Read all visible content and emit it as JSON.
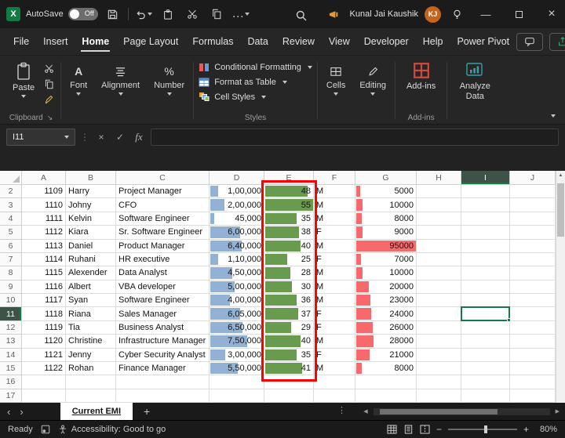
{
  "window": {
    "autosave_label": "AutoSave",
    "autosave_state": "Off",
    "user_name": "Kunal Jai Kaushik",
    "user_initials": "KJ"
  },
  "menu": {
    "tabs": [
      "File",
      "Insert",
      "Home",
      "Page Layout",
      "Formulas",
      "Data",
      "Review",
      "View",
      "Developer",
      "Help",
      "Power Pivot"
    ],
    "active": "Home"
  },
  "ribbon": {
    "paste": "Paste",
    "clipboard_group": "Clipboard",
    "font": "Font",
    "alignment": "Alignment",
    "number": "Number",
    "number_icon": "%",
    "font_icon": "A",
    "styles_items": [
      "Conditional Formatting",
      "Format as Table",
      "Cell Styles"
    ],
    "styles_group": "Styles",
    "cells": "Cells",
    "editing": "Editing",
    "addins": "Add-ins",
    "addins_group": "Add-ins",
    "analyze": "Analyze Data"
  },
  "formula_bar": {
    "name_box": "I11",
    "fx": "fx",
    "value": ""
  },
  "sheet": {
    "column_headers": [
      "A",
      "B",
      "C",
      "D",
      "E",
      "F",
      "G",
      "H",
      "I",
      "J"
    ],
    "selected_column": "I",
    "selected_row": "11",
    "active_cell": "I11",
    "rows": [
      {
        "row": "2",
        "id": "1109",
        "name": "Harry",
        "title": "Project Manager",
        "salary": "1,00,000",
        "salary_pct": 14,
        "age": "48",
        "age_pct": 87,
        "gender": "M",
        "emi": "5000",
        "emi_pct": 6
      },
      {
        "row": "3",
        "id": "1110",
        "name": "Johny",
        "title": "CFO",
        "salary": "2,00,000",
        "salary_pct": 26,
        "age": "55",
        "age_pct": 100,
        "gender": "M",
        "emi": "10000",
        "emi_pct": 11
      },
      {
        "row": "4",
        "id": "1111",
        "name": "Kelvin",
        "title": "Software Engineer",
        "salary": "45,000",
        "salary_pct": 7,
        "age": "35",
        "age_pct": 64,
        "gender": "M",
        "emi": "8000",
        "emi_pct": 9
      },
      {
        "row": "5",
        "id": "1112",
        "name": "Kiara",
        "title": "Sr. Software Engineer",
        "salary": "6,00,000",
        "salary_pct": 55,
        "age": "38",
        "age_pct": 69,
        "gender": "F",
        "emi": "9000",
        "emi_pct": 10
      },
      {
        "row": "6",
        "id": "1113",
        "name": "Daniel",
        "title": "Product Manager",
        "salary": "6,40,000",
        "salary_pct": 58,
        "age": "40",
        "age_pct": 73,
        "gender": "M",
        "emi": "95000",
        "emi_pct": 100
      },
      {
        "row": "7",
        "id": "1114",
        "name": "Ruhani",
        "title": "HR executive",
        "salary": "1,10,000",
        "salary_pct": 15,
        "age": "25",
        "age_pct": 45,
        "gender": "F",
        "emi": "7000",
        "emi_pct": 8
      },
      {
        "row": "8",
        "id": "1115",
        "name": "Alexender",
        "title": "Data Analyst",
        "salary": "4,50,000",
        "salary_pct": 41,
        "age": "28",
        "age_pct": 51,
        "gender": "M",
        "emi": "10000",
        "emi_pct": 11
      },
      {
        "row": "9",
        "id": "1116",
        "name": "Albert",
        "title": "VBA developer",
        "salary": "5,00,000",
        "salary_pct": 45,
        "age": "30",
        "age_pct": 55,
        "gender": "M",
        "emi": "20000",
        "emi_pct": 21
      },
      {
        "row": "10",
        "id": "1117",
        "name": "Syan",
        "title": "Software Engineer",
        "salary": "4,00,000",
        "salary_pct": 36,
        "age": "36",
        "age_pct": 65,
        "gender": "M",
        "emi": "23000",
        "emi_pct": 24
      },
      {
        "row": "11",
        "id": "1118",
        "name": "Riana",
        "title": "Sales Manager",
        "salary": "6,05,000",
        "salary_pct": 55,
        "age": "37",
        "age_pct": 67,
        "gender": "F",
        "emi": "24000",
        "emi_pct": 25
      },
      {
        "row": "12",
        "id": "1119",
        "name": "Tia",
        "title": "Business Analyst",
        "salary": "6,50,000",
        "salary_pct": 59,
        "age": "29",
        "age_pct": 53,
        "gender": "F",
        "emi": "26000",
        "emi_pct": 27
      },
      {
        "row": "13",
        "id": "1120",
        "name": "Christine",
        "title": "Infrastructure Manager",
        "salary": "7,50,000",
        "salary_pct": 68,
        "age": "40",
        "age_pct": 73,
        "gender": "M",
        "emi": "28000",
        "emi_pct": 29
      },
      {
        "row": "14",
        "id": "1121",
        "name": "Jenny",
        "title": "Cyber Security Analyst",
        "salary": "3,00,000",
        "salary_pct": 27,
        "age": "35",
        "age_pct": 64,
        "gender": "F",
        "emi": "21000",
        "emi_pct": 22
      },
      {
        "row": "15",
        "id": "1122",
        "name": "Rohan",
        "title": "Finance Manager",
        "salary": "5,50,000",
        "salary_pct": 50,
        "age": "41",
        "age_pct": 75,
        "gender": "M",
        "emi": "8000",
        "emi_pct": 9
      },
      {
        "row": "16"
      },
      {
        "row": "17"
      }
    ]
  },
  "sheet_tabs": {
    "active_tab": "Current EMI"
  },
  "status_bar": {
    "ready": "Ready",
    "accessibility": "Accessibility: Good to go",
    "zoom": "80%"
  },
  "colors": {
    "salary_bar": "#92b1d4",
    "age_bar": "#699b4e",
    "emi_bar": "#f8696b",
    "annotation_box": "#fe0000",
    "selection": "#107c41",
    "header_selected": "#3d5348"
  },
  "icons": {
    "plus": "+",
    "minus": "−",
    "close": "×",
    "minimize": "—",
    "check": "✓",
    "cancel": "×",
    "ellipsis": "…",
    "vdots": "⋮",
    "chevron-left": "‹",
    "chevron-right": "›",
    "triangle-left": "◀",
    "triangle-right": "▶",
    "triangle-up": "▲",
    "launcher": "↘"
  }
}
